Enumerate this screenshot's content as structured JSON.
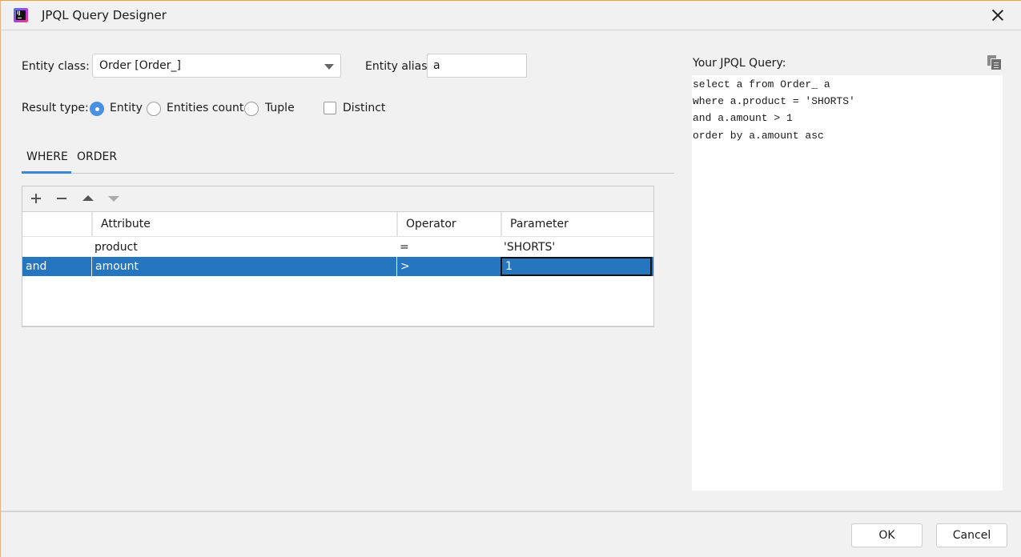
{
  "window": {
    "title": "JPQL Query Designer",
    "app_icon": "intellij-idea-icon",
    "close_icon": "close-icon"
  },
  "form": {
    "entity_class_label": "Entity class:",
    "entity_class_value": "Order [Order_]",
    "entity_alias_label": "Entity alias:",
    "entity_alias_value": "a",
    "result_type_label": "Result type:",
    "result_types": [
      {
        "label": "Entity",
        "checked": true
      },
      {
        "label": "Entities count",
        "checked": false
      },
      {
        "label": "Tuple",
        "checked": false
      }
    ],
    "distinct_label": "Distinct",
    "distinct_checked": false
  },
  "tabs": [
    {
      "label": "WHERE",
      "active": true
    },
    {
      "label": "ORDER",
      "active": false
    }
  ],
  "toolbar": {
    "add_icon": "plus-icon",
    "remove_icon": "minus-icon",
    "move_up_icon": "triangle-up-icon",
    "move_down_icon": "triangle-down-icon"
  },
  "table": {
    "columns": [
      "",
      "Attribute",
      "Operator",
      "Parameter"
    ],
    "rows": [
      {
        "conjunction": "",
        "attribute": "product",
        "operator": "=",
        "parameter": "'SHORTS'",
        "selected": false
      },
      {
        "conjunction": "and",
        "attribute": "amount",
        "operator": ">",
        "parameter": "1",
        "selected": true
      }
    ]
  },
  "query": {
    "label": "Your JPQL Query:",
    "copy_icon": "copy-icon",
    "lines": [
      "select a from Order_ a",
      "where a.product = 'SHORTS'",
      "and a.amount > 1",
      "order by a.amount asc"
    ]
  },
  "buttons": {
    "ok": "OK",
    "cancel": "Cancel"
  },
  "colors": {
    "accent": "#3f86d6",
    "selection": "#2675bf",
    "radio_checked": "#4a90e2",
    "window_border": "#f0a030"
  }
}
